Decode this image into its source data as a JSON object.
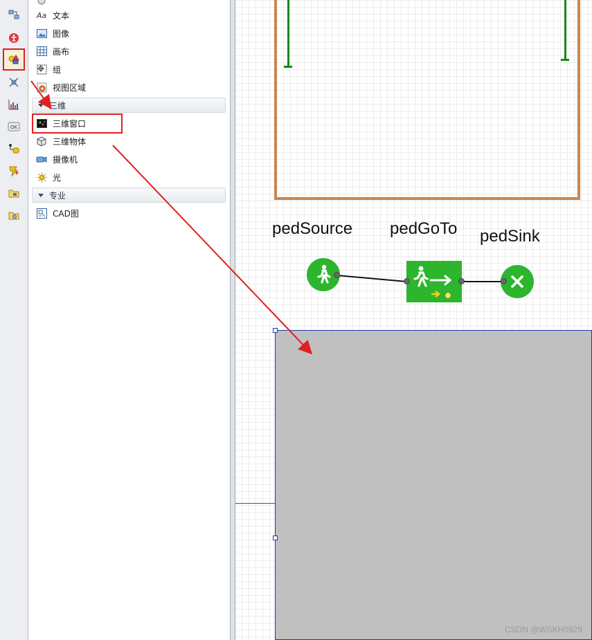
{
  "toolbar": {
    "buttons": [
      {
        "icon": "connectors-icon"
      },
      {
        "icon": "accessibility-icon"
      },
      {
        "icon": "presentation-shapes-icon",
        "active": true
      },
      {
        "icon": "markup-icon"
      },
      {
        "icon": "analysis-chart-icon"
      },
      {
        "icon": "controls-ok-icon"
      },
      {
        "icon": "statechart-icon"
      },
      {
        "icon": "actions-icon"
      },
      {
        "icon": "folder-icon"
      },
      {
        "icon": "folder-pictures-icon"
      }
    ]
  },
  "palette": {
    "items_2d": [
      {
        "label": "文本",
        "icon": "text-aa-icon"
      },
      {
        "label": "图像",
        "icon": "image-icon"
      },
      {
        "label": "画布",
        "icon": "canvas-grid-icon"
      },
      {
        "label": "组",
        "icon": "group-icon"
      },
      {
        "label": "视图区域",
        "icon": "view-area-icon"
      }
    ],
    "section_3d": "三维",
    "items_3d": [
      {
        "label": "三维窗口",
        "icon": "window-3d-icon"
      },
      {
        "label": "三维物体",
        "icon": "object-3d-icon"
      },
      {
        "label": "摄像机",
        "icon": "camera-icon"
      },
      {
        "label": "光",
        "icon": "light-icon"
      }
    ],
    "section_pro": "专业",
    "items_pro": [
      {
        "label": "CAD图",
        "icon": "cad-icon"
      }
    ]
  },
  "canvas": {
    "nodes": {
      "source_label": "pedSource",
      "goto_label": "pedGoTo",
      "sink_label": "pedSink"
    },
    "colors": {
      "node_green": "#2db52d",
      "wall_orange": "#c8864f",
      "post_green": "#148a14",
      "view3d_gray": "#c0c0c0",
      "annotation_red": "#e02020"
    }
  },
  "watermark": "CSDN @WSKH0929"
}
